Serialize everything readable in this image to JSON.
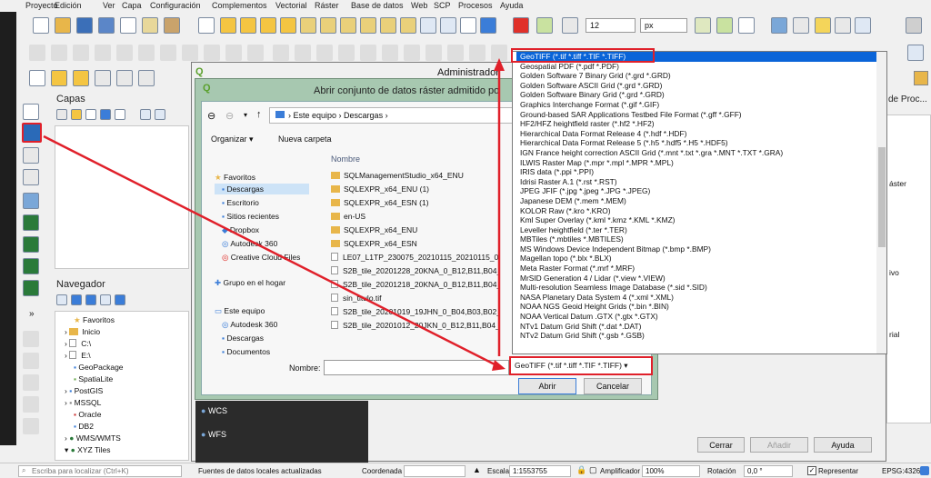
{
  "menu": [
    "Proyecto",
    "Edición",
    "Ver",
    "Capa",
    "Configuración",
    "Complementos",
    "Vectorial",
    "Ráster",
    "Base de datos",
    "Web",
    "SCP",
    "Procesos",
    "Ayuda"
  ],
  "toolbar": {
    "size_value": "12",
    "size_unit": "px"
  },
  "layers_panel": {
    "title": "Capas"
  },
  "navigator_panel": {
    "title": "Navegador",
    "items": [
      "Favoritos",
      "Inicio",
      "C:\\",
      "E:\\",
      "GeoPackage",
      "SpatiaLite",
      "PostGIS",
      "MSSQL",
      "Oracle",
      "DB2",
      "WMS/WMTS",
      "XYZ Tiles"
    ]
  },
  "qgis_dialog": {
    "title": "Administrador",
    "items": [
      "WCS",
      "WFS"
    ]
  },
  "open_dialog": {
    "title": "Abrir conjunto de datos ráster admitido po",
    "breadcrumb": [
      "Este equipo",
      "Descargas"
    ],
    "organize": "Organizar",
    "new_folder": "Nueva carpeta",
    "column_name": "Nombre",
    "sidebar": [
      "Favoritos",
      "Descargas",
      "Escritorio",
      "Sitios recientes",
      "Dropbox",
      "Autodesk 360",
      "Creative Cloud Files",
      "Grupo en el hogar",
      "Este equipo",
      "Autodesk 360",
      "Descargas",
      "Documentos"
    ],
    "files": [
      "SQLManagementStudio_x64_ENU",
      "SQLEXPR_x64_ENU (1)",
      "SQLEXPR_x64_ESN (1)",
      "en-US",
      "SQLEXPR_x64_ENU",
      "SQLEXPR_x64_ESN",
      "LE07_L1TP_230075_20210115_20210115_01_RT_B",
      "S2B_tile_20201228_20KNA_0_B12,B11,B04_S_[-6",
      "S2B_tile_20201218_20KNA_0_B12,B11,B04_M_[-6",
      "sin_titulo.tif",
      "S2B_tile_20201019_19JHN_0_B04,B03,B02_M_[-6",
      "S2B_tile_20201012_20JKN_0_B12,B11,B04_M_[-65"
    ],
    "filename_label": "Nombre:",
    "filter_value": "GeoTIFF (*.tif *.tiff *.TIF *.TIFF)",
    "open_button": "Abrir",
    "cancel_button": "Cancelar"
  },
  "format_list": [
    "GeoTIFF (*.tif *.tiff *.TIF *.TIFF)",
    "Geospatial PDF (*.pdf *.PDF)",
    "Golden Software 7 Binary Grid (*.grd *.GRD)",
    "Golden Software ASCII Grid (*.grd *.GRD)",
    "Golden Software Binary Grid (*.grd *.GRD)",
    "Graphics Interchange Format (*.gif *.GIF)",
    "Ground-based SAR Applications Testbed File Format (*.gff *.GFF)",
    "HF2/HFZ heightfield raster (*.hf2 *.HF2)",
    "Hierarchical Data Format Release 4 (*.hdf *.HDF)",
    "Hierarchical Data Format Release 5 (*.h5 *.hdf5 *.H5 *.HDF5)",
    "IGN France height correction ASCII Grid (*.mnt *.txt *.gra *.MNT *.TXT *.GRA)",
    "ILWIS Raster Map (*.mpr *.mpl *.MPR *.MPL)",
    "IRIS data (*.ppi *.PPI)",
    "Idrisi Raster A.1 (*.rst *.RST)",
    "JPEG JFIF (*.jpg *.jpeg *.JPG *.JPEG)",
    "Japanese DEM (*.mem *.MEM)",
    "KOLOR Raw (*.kro *.KRO)",
    "Kml Super Overlay (*.kml *.kmz *.KML *.KMZ)",
    "Leveller heightfield (*.ter *.TER)",
    "MBTiles (*.mbtiles *.MBTILES)",
    "MS Windows Device Independent Bitmap (*.bmp *.BMP)",
    "Magellan topo (*.blx *.BLX)",
    "Meta Raster Format (*.mrf *.MRF)",
    "MrSID Generation 4 / Lidar (*.view *.VIEW)",
    "Multi-resolution Seamless Image Database (*.sid *.SID)",
    "NASA Planetary Data System 4 (*.xml *.XML)",
    "NOAA NGS Geoid Height Grids (*.bin *.BIN)",
    "NOAA Vertical Datum .GTX (*.gtx *.GTX)",
    "NTv1 Datum Grid Shift (*.dat *.DAT)",
    "NTv2 Datum Grid Shift (*.gsb *.GSB)"
  ],
  "right_side": {
    "title": "de Proc...",
    "items": [
      "áster",
      "ivo",
      "rial"
    ]
  },
  "bottom_buttons": {
    "close": "Cerrar",
    "add": "Añadir",
    "help": "Ayuda"
  },
  "status": {
    "search_placeholder": "Escriba para localizar (Ctrl+K)",
    "message": "Fuentes de datos locales actualizadas",
    "coord_label": "Coordenada",
    "scale_label": "Escala",
    "scale_value": "1:1553755",
    "magnifier_label": "Amplificador",
    "magnifier_value": "100%",
    "rotation_label": "Rotación",
    "rotation_value": "0,0 °",
    "render_label": "Representar",
    "crs": "EPSG:4326"
  }
}
